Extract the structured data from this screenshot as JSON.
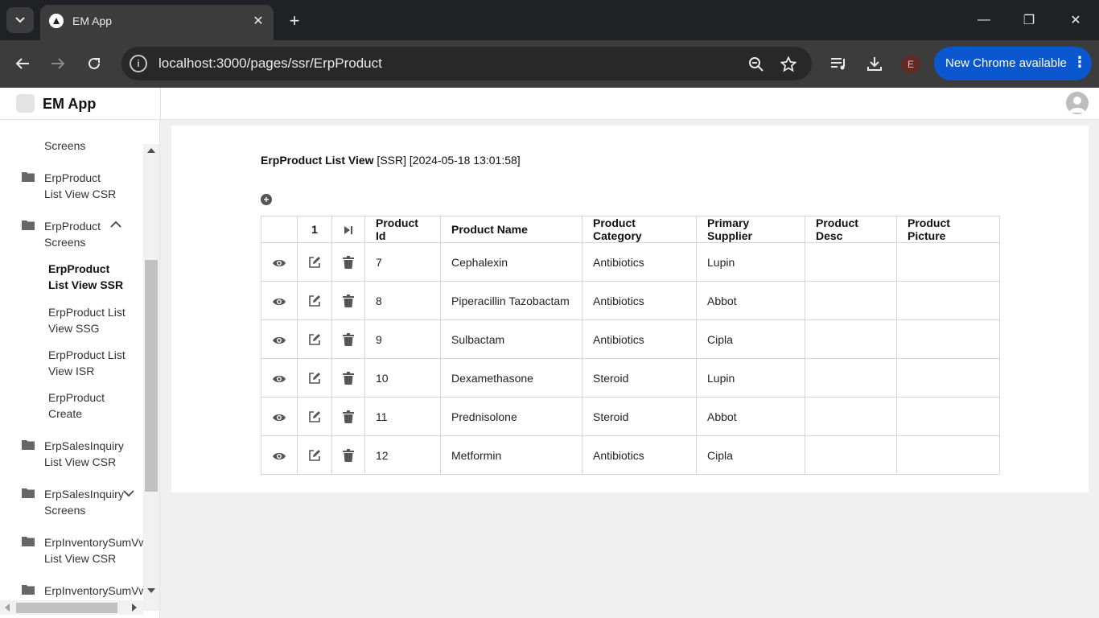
{
  "browser": {
    "tab_title": "EM App",
    "url": "localhost:3000/pages/ssr/ErpProduct",
    "profile_initial": "E",
    "update_label": "New Chrome available"
  },
  "app": {
    "name": "EM App"
  },
  "sidebar": {
    "items": [
      {
        "line1": "",
        "line2": "Screens"
      },
      {
        "line1": "ErpProduct",
        "line2": "List View CSR"
      },
      {
        "line1": "ErpProduct",
        "line2": "Screens"
      },
      {
        "line1": "ErpSalesInquiry",
        "line2": "List View CSR"
      },
      {
        "line1": "ErpSalesInquiry",
        "line2": "Screens"
      },
      {
        "line1": "ErpInventorySumVw",
        "line2": "List View CSR"
      },
      {
        "line1": "ErpInventorySumVw",
        "line2": ""
      }
    ],
    "subitems": [
      {
        "line1": "ErpProduct",
        "line2": "List View SSR"
      },
      {
        "line1": "ErpProduct List",
        "line2": "View SSG"
      },
      {
        "line1": "ErpProduct List",
        "line2": "View ISR"
      },
      {
        "line1": "ErpProduct",
        "line2": "Create"
      }
    ]
  },
  "main": {
    "title_bold": "ErpProduct List View",
    "title_rest": " [SSR] [2024-05-18 13:01:58]",
    "page_number": "1",
    "columns": [
      "Product Id",
      "Product Name",
      "Product Category",
      "Primary Supplier",
      "Product Desc",
      "Product Picture"
    ],
    "rows": [
      {
        "id": "7",
        "name": "Cephalexin",
        "category": "Antibiotics",
        "supplier": "Lupin",
        "desc": "",
        "picture": ""
      },
      {
        "id": "8",
        "name": "Piperacillin Tazobactam",
        "category": "Antibiotics",
        "supplier": "Abbot",
        "desc": "",
        "picture": ""
      },
      {
        "id": "9",
        "name": "Sulbactam",
        "category": "Antibiotics",
        "supplier": "Cipla",
        "desc": "",
        "picture": ""
      },
      {
        "id": "10",
        "name": "Dexamethasone",
        "category": "Steroid",
        "supplier": "Lupin",
        "desc": "",
        "picture": ""
      },
      {
        "id": "11",
        "name": "Prednisolone",
        "category": "Steroid",
        "supplier": "Abbot",
        "desc": "",
        "picture": ""
      },
      {
        "id": "12",
        "name": "Metformin",
        "category": "Antibiotics",
        "supplier": "Cipla",
        "desc": "",
        "picture": ""
      }
    ]
  },
  "colors": {
    "chrome_bg": "#202124",
    "toolbar_bg": "#3c3c3c",
    "update_blue": "#0b57d0",
    "icon_gray": "#555555"
  }
}
